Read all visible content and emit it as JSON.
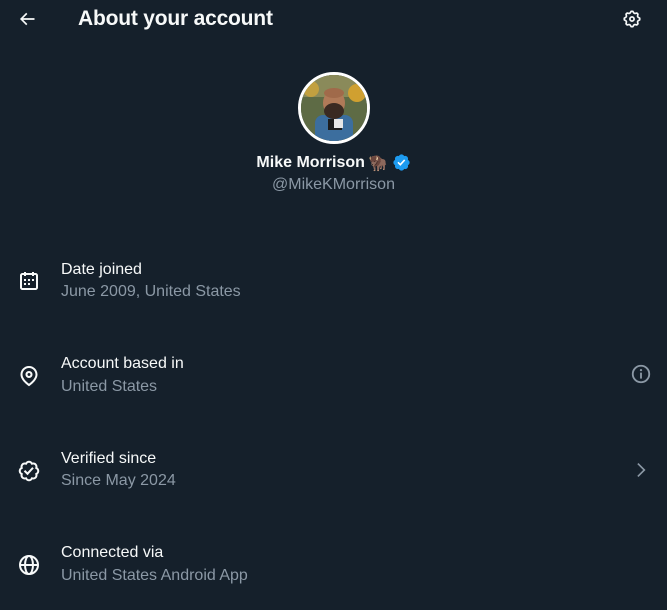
{
  "header": {
    "title": "About your account",
    "back_icon": "arrow-left-icon",
    "settings_icon": "gear-icon"
  },
  "profile": {
    "name": "Mike Morrison",
    "emoji": "🦬",
    "verified_icon": "verified-badge-icon",
    "handle": "@MikeKMorrison"
  },
  "rows": [
    {
      "title": "Date joined",
      "subtitle": "June 2009, United States",
      "icon": "calendar-icon"
    },
    {
      "title": "Account based in",
      "subtitle": "United States",
      "icon": "location-pin-icon",
      "right_icon": "info-icon"
    },
    {
      "title": "Verified since",
      "subtitle": "Since May 2024",
      "icon": "verified-check-icon",
      "right_icon": "chevron-right-icon"
    },
    {
      "title": "Connected via",
      "subtitle": "United States Android App",
      "icon": "globe-icon"
    }
  ],
  "colors": {
    "background": "#15202b",
    "text_primary": "#f7f9f9",
    "text_secondary": "#8b98a5",
    "verified_blue": "#1d9bf0"
  }
}
